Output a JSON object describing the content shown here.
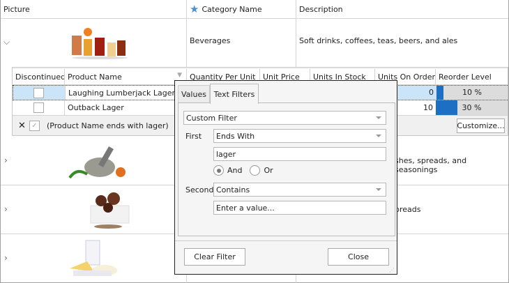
{
  "columns": {
    "picture": "Picture",
    "category": "Category Name",
    "description": "Description"
  },
  "categories": [
    {
      "name": "Beverages",
      "description": "Soft drinks, coffees, teas, beers, and ales",
      "expanded": true
    },
    {
      "name": "",
      "description": "shes, spreads, and seasonings",
      "expanded": false
    },
    {
      "name": "",
      "description": "breads",
      "expanded": false
    },
    {
      "name": "",
      "description": "",
      "expanded": false
    }
  ],
  "detail": {
    "headers": [
      "Discontinued",
      "Product Name",
      "Quantity Per Unit",
      "Unit Price",
      "Units In Stock",
      "Units On Order",
      "Reorder Level"
    ],
    "rows": [
      {
        "discontinued": false,
        "product": "Laughing Lumberjack Lager",
        "on_order": "0",
        "reorder": "10 %",
        "reorder_pct": 10
      },
      {
        "discontinued": false,
        "product": "Outback Lager",
        "on_order": "10",
        "reorder": "30 %",
        "reorder_pct": 30
      }
    ],
    "filter_text": "(Product Name ends with lager)",
    "customize": "Customize..."
  },
  "popup": {
    "tabs": [
      "Values",
      "Text Filters"
    ],
    "mode": "Custom Filter",
    "first_label": "First",
    "first_op": "Ends With",
    "first_value": "lager",
    "and": "And",
    "or": "Or",
    "second_label": "Second",
    "second_op": "Contains",
    "second_placeholder": "Enter a value...",
    "clear": "Clear Filter",
    "close": "Close"
  },
  "colors": {
    "accent": "#1c6fc2",
    "selected": "#cce4f7"
  }
}
